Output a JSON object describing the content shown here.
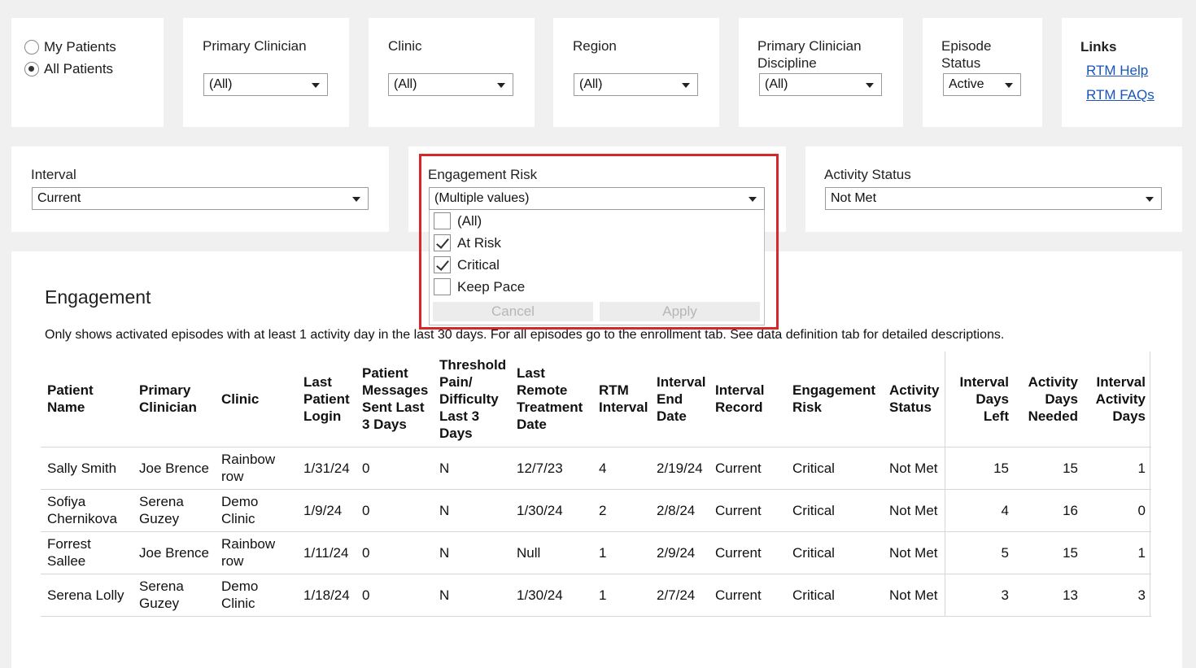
{
  "filters": {
    "patients": {
      "my": "My Patients",
      "all": "All Patients",
      "selected": "All Patients"
    },
    "primary_clinician": {
      "label": "Primary Clinician",
      "value": "(All)"
    },
    "clinic": {
      "label": "Clinic",
      "value": "(All)"
    },
    "region": {
      "label": "Region",
      "value": "(All)"
    },
    "discipline": {
      "label": "Primary Clinician Discipline",
      "value": "(All)"
    },
    "episode_status": {
      "label": "Episode Status",
      "value": "Active"
    },
    "links": {
      "title": "Links",
      "help": "RTM Help",
      "faqs": "RTM FAQs"
    },
    "interval": {
      "label": "Interval",
      "value": "Current"
    },
    "engagement_risk": {
      "label": "Engagement Risk",
      "value": "(Multiple values)",
      "options": [
        {
          "label": "(All)",
          "checked": false
        },
        {
          "label": "At Risk",
          "checked": true
        },
        {
          "label": "Critical",
          "checked": true
        },
        {
          "label": "Keep Pace",
          "checked": false
        }
      ],
      "cancel": "Cancel",
      "apply": "Apply"
    },
    "activity_status": {
      "label": "Activity Status",
      "value": "Not Met"
    }
  },
  "engagement": {
    "title": "Engagement",
    "description": "Only shows activated episodes with at least 1 activity day in the last 30 days. For all episodes go to the enrollment tab. See data definition tab for detailed descriptions.",
    "headers": {
      "patient_name": [
        "Patient",
        "Name"
      ],
      "primary_clinician": [
        "Primary",
        "Clinician"
      ],
      "clinic": [
        "Clinic"
      ],
      "last_login": [
        "Last",
        "Patient",
        "Login"
      ],
      "messages": [
        "Patient",
        "Messages",
        "Sent Last",
        "3 Days"
      ],
      "threshold": [
        "Threshold",
        "Pain/",
        "Difficulty",
        "Last 3",
        "Days"
      ],
      "last_remote": [
        "Last",
        "Remote",
        "Treatment",
        "Date"
      ],
      "rtm_interval": [
        "RTM",
        "Interval"
      ],
      "interval_end": [
        "Interval",
        "End",
        "Date"
      ],
      "interval_record": [
        "Interval",
        "Record"
      ],
      "engagement_risk": [
        "Engagement",
        "Risk"
      ],
      "activity_status": [
        "Activity",
        "Status"
      ],
      "days_left": [
        "Interval",
        "Days",
        "Left"
      ],
      "days_needed": [
        "Activity",
        "Days",
        "Needed"
      ],
      "activity_days": [
        "Interval",
        "Activity",
        "Days"
      ]
    },
    "rows": [
      {
        "patient_name": [
          "Sally Smith"
        ],
        "primary_clinician": [
          "Joe Brence"
        ],
        "clinic": [
          "Rainbow",
          "row"
        ],
        "last_login": "1/31/24",
        "messages": "0",
        "threshold": "N",
        "last_remote": "12/7/23",
        "rtm_interval": "4",
        "interval_end": "2/19/24",
        "interval_record": "Current",
        "engagement_risk": "Critical",
        "activity_status": "Not Met",
        "days_left": "15",
        "days_needed": "15",
        "activity_days": "1"
      },
      {
        "patient_name": [
          "Sofiya",
          "Chernikova"
        ],
        "primary_clinician": [
          "Serena",
          "Guzey"
        ],
        "clinic": [
          "Demo",
          "Clinic"
        ],
        "last_login": "1/9/24",
        "messages": "0",
        "threshold": "N",
        "last_remote": "1/30/24",
        "rtm_interval": "2",
        "interval_end": "2/8/24",
        "interval_record": "Current",
        "engagement_risk": "Critical",
        "activity_status": "Not Met",
        "days_left": "4",
        "days_needed": "16",
        "activity_days": "0"
      },
      {
        "patient_name": [
          "Forrest",
          "Sallee"
        ],
        "primary_clinician": [
          "Joe Brence"
        ],
        "clinic": [
          "Rainbow",
          "row"
        ],
        "last_login": "1/11/24",
        "messages": "0",
        "threshold": "N",
        "last_remote": "Null",
        "rtm_interval": "1",
        "interval_end": "2/9/24",
        "interval_record": "Current",
        "engagement_risk": "Critical",
        "activity_status": "Not Met",
        "days_left": "5",
        "days_needed": "15",
        "activity_days": "1"
      },
      {
        "patient_name": [
          "Serena Lolly"
        ],
        "primary_clinician": [
          "Serena",
          "Guzey"
        ],
        "clinic": [
          "Demo",
          "Clinic"
        ],
        "last_login": "1/18/24",
        "messages": "0",
        "threshold": "N",
        "last_remote": "1/30/24",
        "rtm_interval": "1",
        "interval_end": "2/7/24",
        "interval_record": "Current",
        "engagement_risk": "Critical",
        "activity_status": "Not Met",
        "days_left": "3",
        "days_needed": "13",
        "activity_days": "3"
      }
    ]
  }
}
